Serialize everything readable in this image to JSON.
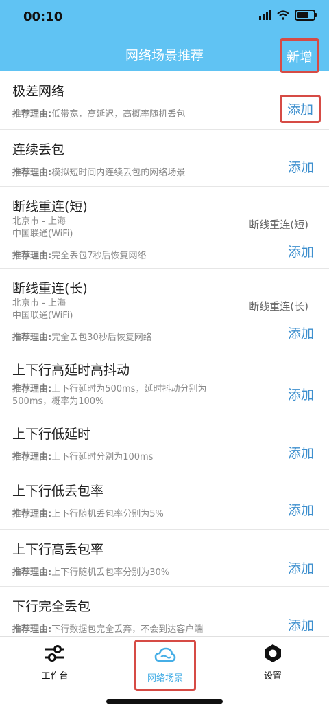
{
  "status": {
    "time": "00:10"
  },
  "header": {
    "title": "网络场景推荐",
    "add_label": "新增"
  },
  "reason_label": "推荐理由:",
  "add_label": "添加",
  "items": [
    {
      "title": "极差网络",
      "reason": "低带宽，高延迟，高概率随机丢包"
    },
    {
      "title": "连续丢包",
      "reason": "模拟短时间内连续丢包的网络场景"
    },
    {
      "title": "断线重连(短)",
      "location": "北京市 - 上海",
      "carrier": "中国联通(WiFi)",
      "tag": "断线重连(短)",
      "reason": "完全丢包7秒后恢复网络"
    },
    {
      "title": "断线重连(长)",
      "location": "北京市 - 上海",
      "carrier": "中国联通(WiFi)",
      "tag": "断线重连(长)",
      "reason": "完全丢包30秒后恢复网络"
    },
    {
      "title": "上下行高延时高抖动",
      "reason": "上下行延时为500ms，延时抖动分别为500ms，概率为100%"
    },
    {
      "title": "上下行低延时",
      "reason": "上下行延时分别为100ms"
    },
    {
      "title": "上下行低丢包率",
      "reason": "上下行随机丢包率分别为5%"
    },
    {
      "title": "上下行高丢包率",
      "reason": "上下行随机丢包率分别为30%"
    },
    {
      "title": "下行完全丢包",
      "reason": "下行数据包完全丢弃，不会到达客户端"
    }
  ],
  "tabs": [
    {
      "label": "工作台",
      "icon": "sliders-icon"
    },
    {
      "label": "网络场景",
      "icon": "cloud-icon",
      "active": true
    },
    {
      "label": "设置",
      "icon": "gear-icon"
    }
  ]
}
